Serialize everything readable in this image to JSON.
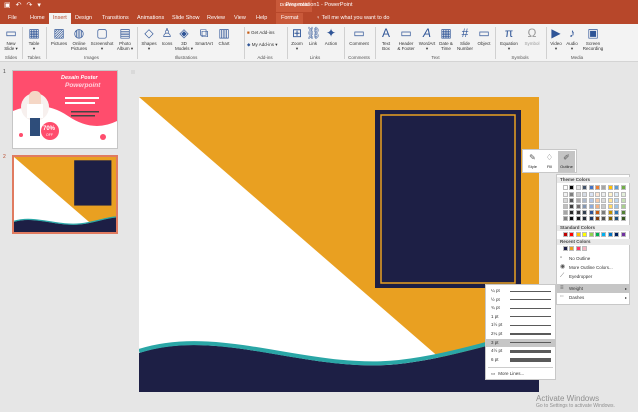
{
  "titlebar": {
    "title": "Presentation1  -  PowerPoint",
    "context_group": "Drawing Tools",
    "undo_icon": "↶",
    "redo_icon": "↷",
    "save_icon": "▣",
    "customize_icon": "▾"
  },
  "tabs": [
    {
      "label": "File"
    },
    {
      "label": "Home"
    },
    {
      "label": "Insert"
    },
    {
      "label": "Design"
    },
    {
      "label": "Transitions"
    },
    {
      "label": "Animations"
    },
    {
      "label": "Slide Show"
    },
    {
      "label": "Review"
    },
    {
      "label": "View"
    },
    {
      "label": "Help"
    },
    {
      "label": "Format"
    }
  ],
  "tell_me": "Tell me what you want to do",
  "ribbon": {
    "buttons": {
      "new_slide": "New\nSlide ▾",
      "table": "Table\n▾",
      "pictures": "Pictures",
      "online_pictures": "Online\nPictures",
      "screenshot": "Screenshot\n▾",
      "photo_album": "Photo\nAlbum ▾",
      "shapes": "Shapes\n▾",
      "icons": "Icons",
      "models_3d": "3D\nModels ▾",
      "smartart": "SmartArt",
      "chart": "Chart",
      "get_addins": "Get Add-ins",
      "my_addins": "My Add-ins ▾",
      "zoom": "Zoom\n▾",
      "link": "Link",
      "action": "Action",
      "comment": "Comment",
      "text_box": "Text\nBox",
      "header_footer": "Header\n& Footer",
      "wordart": "WordArt\n▾",
      "date_time": "Date &\nTime",
      "slide_number": "Slide\nNumber",
      "object": "Object",
      "equation": "Equation\n▾",
      "symbol": "Symbol",
      "video": "Video\n▾",
      "audio": "Audio\n▾",
      "screen_recording": "Screen\nRecording"
    },
    "groups": {
      "slides": "Slides",
      "tables": "Tables",
      "images": "Images",
      "illustrations": "Illustrations",
      "addins": "Add-ins",
      "links": "Links",
      "comments": "Comments",
      "text": "Text",
      "symbols": "Symbols",
      "media": "Media"
    }
  },
  "thumbnails": [
    {
      "number": "1",
      "title": "Desain Poster",
      "subtitle": "Powerpoint",
      "badge": "70%",
      "badge_sub": "OFF"
    },
    {
      "number": "2"
    }
  ],
  "mini_toolbar": {
    "style": "Style",
    "fill": "Fill",
    "outline": "Outline"
  },
  "outline_menu": {
    "theme_colors": "Theme Colors",
    "standard_colors": "Standard Colors",
    "recent_colors": "Recent Colors",
    "no_outline": "No Outline",
    "more_outline_colors": "More Outline Colors...",
    "eyedropper": "Eyedropper",
    "weight": "Weight",
    "dashes": "Dashes",
    "theme_palette": [
      [
        "#ffffff",
        "#000000",
        "#e7e6e6",
        "#44546a",
        "#4472c4",
        "#ed7d31",
        "#a5a5a5",
        "#ffc000",
        "#5b9bd5",
        "#70ad47"
      ],
      [
        "#f2f2f2",
        "#7f7f7f",
        "#d0cece",
        "#d6dce4",
        "#d9e2f3",
        "#fbe5d5",
        "#ededed",
        "#fff2cc",
        "#deebf6",
        "#e2efd9"
      ],
      [
        "#d8d8d8",
        "#595959",
        "#aeabab",
        "#adb9ca",
        "#b4c6e7",
        "#f7cbac",
        "#dbdbdb",
        "#fee599",
        "#bdd7ee",
        "#c5e0b3"
      ],
      [
        "#bfbfbf",
        "#3f3f3f",
        "#757070",
        "#8496b0",
        "#8eaadb",
        "#f4b183",
        "#c9c9c9",
        "#ffd965",
        "#9cc3e5",
        "#a8d08d"
      ],
      [
        "#a5a5a5",
        "#262626",
        "#3a3838",
        "#323f4f",
        "#2f5496",
        "#c55a11",
        "#7b7b7b",
        "#bf9000",
        "#2e75b5",
        "#538135"
      ],
      [
        "#7f7f7f",
        "#0c0c0c",
        "#171616",
        "#222a35",
        "#1f3864",
        "#833c0b",
        "#525252",
        "#7f6000",
        "#1e4e79",
        "#375623"
      ]
    ],
    "standard_palette": [
      "#c00000",
      "#ff0000",
      "#ffc000",
      "#ffff00",
      "#92d050",
      "#00b050",
      "#00b0f0",
      "#0070c0",
      "#002060",
      "#7030a0"
    ],
    "recent_palette": [
      "#1d1f45",
      "#e9a021",
      "#ff3366",
      "#f4b6c2"
    ]
  },
  "weight_menu": {
    "items": [
      {
        "label": "¼ pt",
        "thickness": 0.3
      },
      {
        "label": "½ pt",
        "thickness": 0.5
      },
      {
        "label": "¾ pt",
        "thickness": 0.75
      },
      {
        "label": "1 pt",
        "thickness": 1
      },
      {
        "label": "1½ pt",
        "thickness": 1.5
      },
      {
        "label": "2¼ pt",
        "thickness": 2.25
      },
      {
        "label": "3 pt",
        "thickness": 3
      },
      {
        "label": "4½ pt",
        "thickness": 4.5
      },
      {
        "label": "6 pt",
        "thickness": 6
      }
    ],
    "selected": "3 pt",
    "more_lines": "More Lines..."
  },
  "watermark": {
    "line1": "Activate Windows",
    "line2": "Go to Settings to activate Windows."
  },
  "colors": {
    "accent": "#b7472a",
    "slide_orange": "#e9a021",
    "slide_navy": "#1d1f45",
    "slide_teal": "#2aa6a6"
  }
}
